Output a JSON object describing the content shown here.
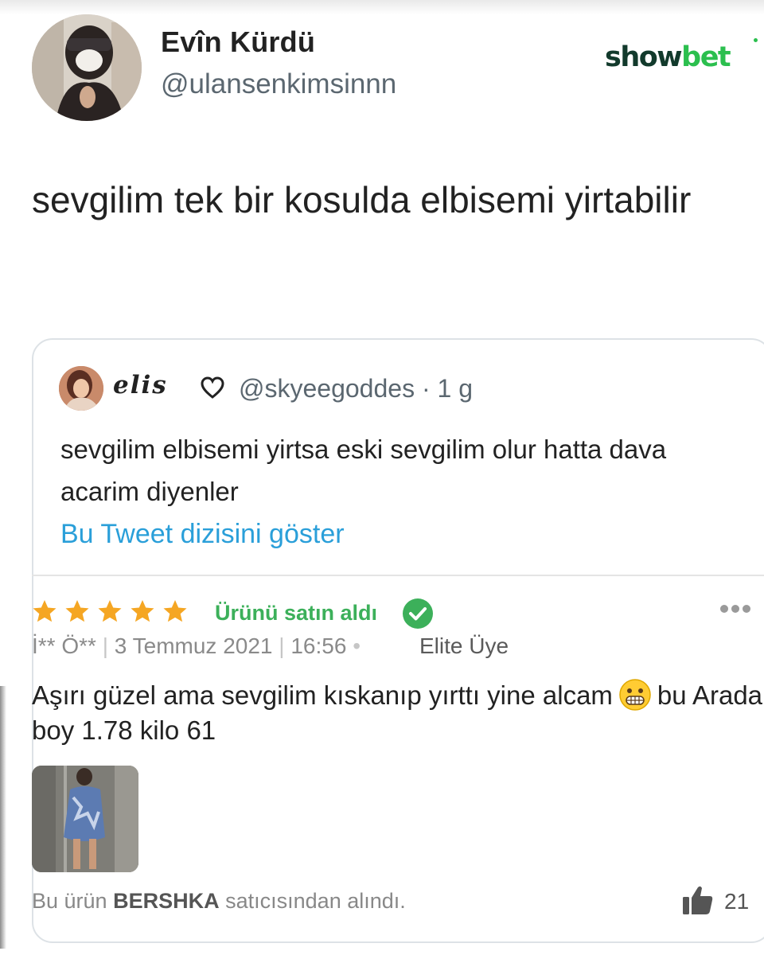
{
  "tweet": {
    "author_name": "Evîn Kürdü",
    "author_handle": "@ulansenkimsinnn",
    "text": "sevgilim tek bir kosulda elbisemi yirtabilir"
  },
  "brand": {
    "show": "show",
    "bet": "bet",
    "colors": {
      "dark": "#123a2c",
      "green": "#2bbf4e"
    }
  },
  "quoted": {
    "name": "𝒆𝒍𝒊𝒔",
    "handle_time": "@skyeegoddes · 1 g",
    "text": "sevgilim elbisemi yirtsa eski sevgilim olur hatta dava acarim diyenler",
    "thread_link": "Bu Tweet dizisini göster",
    "link_color": "#2a9fd9"
  },
  "review": {
    "rating": 5,
    "rating_max": 5,
    "star_color": "#f5a623",
    "bought_label": "Ürünü satın aldı",
    "user": "İ** Ö**",
    "date": "3 Temmuz 2021",
    "time": "16:56",
    "member_level": "Elite Üye",
    "text_part1": "Aşırı güzel ama sevgilim kıskanıp yırttı yine alcam",
    "text_part2": "bu Arada boy 1.78 kilo 61",
    "emoji": "grimacing-face-icon",
    "seller_prefix": "Bu ürün",
    "seller_name": "BERSHKA",
    "seller_suffix": "satıcısından alındı.",
    "likes": "21"
  }
}
